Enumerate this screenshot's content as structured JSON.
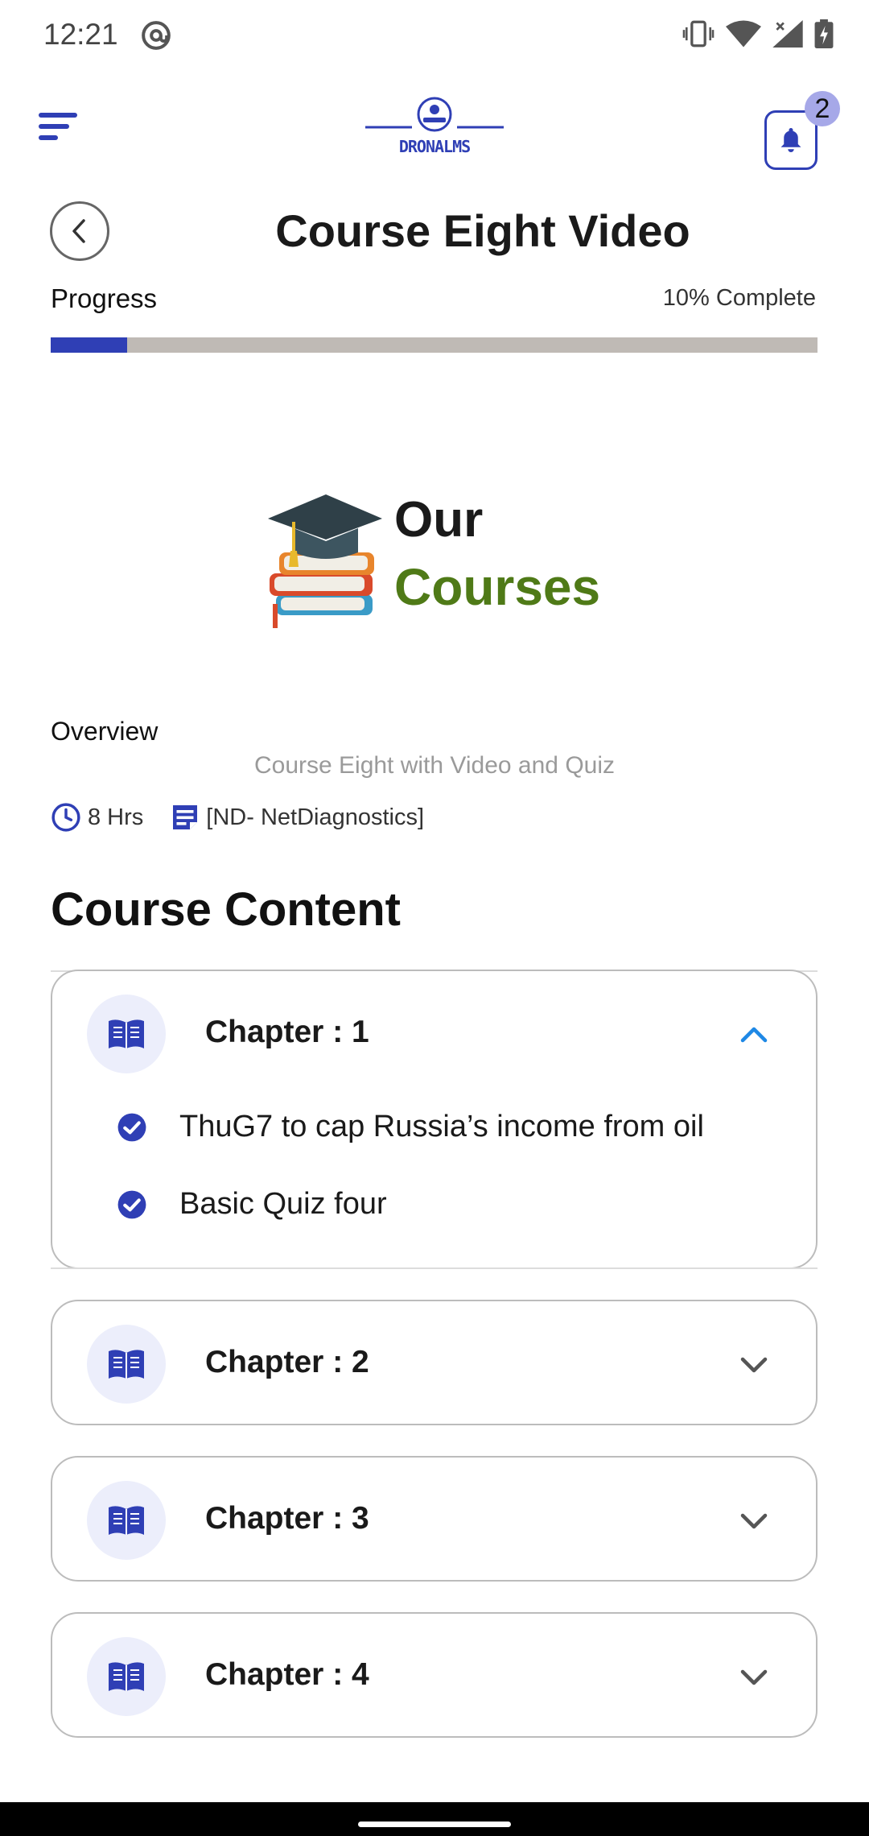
{
  "status_bar": {
    "time": "12:21"
  },
  "header": {
    "logo_text": "DRONALMS",
    "notification_count": "2"
  },
  "page": {
    "title": "Course Eight Video"
  },
  "progress": {
    "label": "Progress",
    "percent_text": "10% Complete",
    "value_percent": 10
  },
  "hero": {
    "line1": "Our",
    "line2": "Courses"
  },
  "overview": {
    "label": "Overview",
    "description": "Course Eight with Video and Quiz",
    "duration": "8 Hrs",
    "category": "[ND- NetDiagnostics]"
  },
  "course_content": {
    "title": "Course Content",
    "chapters": [
      {
        "label": "Chapter : 1",
        "expanded": true,
        "lessons": [
          {
            "title": "ThuG7 to cap Russia’s income from oil",
            "completed": true
          },
          {
            "title": "Basic Quiz four",
            "completed": true
          }
        ]
      },
      {
        "label": "Chapter : 2",
        "expanded": false
      },
      {
        "label": "Chapter : 3",
        "expanded": false
      },
      {
        "label": "Chapter : 4",
        "expanded": false
      }
    ]
  },
  "colors": {
    "accent": "#2f3fb5",
    "progress_track": "#bfbab5",
    "chevron_expanded": "#1e88e5",
    "badge_bg": "#a6a8e8",
    "hero_green": "#4f7a17"
  }
}
